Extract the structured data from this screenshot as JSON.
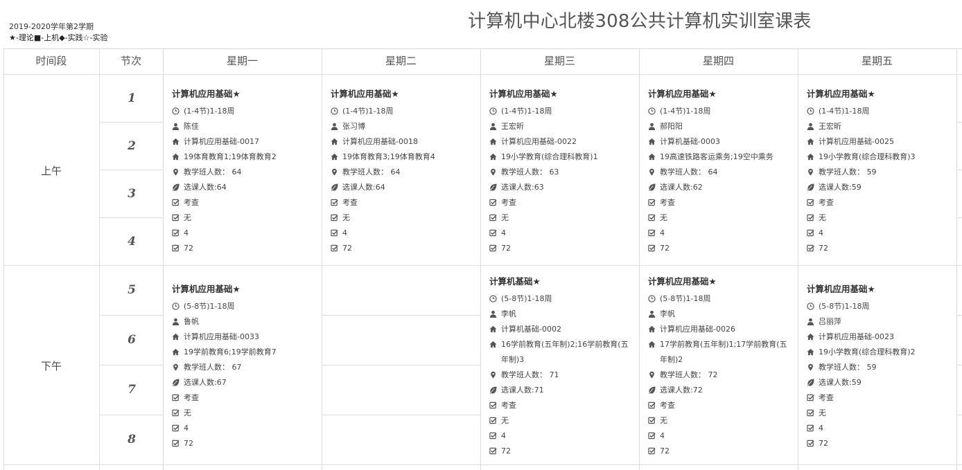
{
  "header": {
    "term": "2019-2020学年第2学期",
    "legend": "★-理论■-上机◆-实践☆-实验",
    "title": "计算机中心北楼308公共计算机实训室课表"
  },
  "columns": {
    "period": "时间段",
    "slot": "节次",
    "days": [
      "星期一",
      "星期二",
      "星期三",
      "星期四",
      "星期五"
    ]
  },
  "periods": [
    "上午",
    "下午"
  ],
  "slots": [
    "1",
    "2",
    "3",
    "4",
    "5",
    "6",
    "7",
    "8"
  ],
  "icons": [
    "clock-icon",
    "user-icon",
    "home-icon",
    "home-icon",
    "marker-icon",
    "leaf-icon",
    "check-icon",
    "check-icon",
    "check-icon",
    "check-icon"
  ],
  "morning": [
    {
      "title": "计算机应用基础★",
      "time": "(1-4节)1-18周",
      "teacher": "陈佳",
      "class_code": "计算机应用基础-0017",
      "classes": "19体育教育1;19体育教育2",
      "class_size": "教学班人数： 64",
      "enrolled": "选课人数:64",
      "exam": "考查",
      "note": "无",
      "weekly": "4",
      "total": "72"
    },
    {
      "title": "计算机应用基础★",
      "time": "(1-4节)1-18周",
      "teacher": "张习博",
      "class_code": "计算机应用基础-0018",
      "classes": "19体育教育3;19体育教育4",
      "class_size": "教学班人数： 64",
      "enrolled": "选课人数:64",
      "exam": "考查",
      "note": "无",
      "weekly": "4",
      "total": "72"
    },
    {
      "title": "计算机应用基础★",
      "time": "(1-4节)1-18周",
      "teacher": "王宏昕",
      "class_code": "计算机应用基础-0022",
      "classes": "19小学教育(综合理科教育)1",
      "class_size": "教学班人数： 63",
      "enrolled": "选课人数:63",
      "exam": "考查",
      "note": "无",
      "weekly": "4",
      "total": "72"
    },
    {
      "title": "计算机应用基础★",
      "time": "(1-4节)1-18周",
      "teacher": "郝阳阳",
      "class_code": "计算机基础-0003",
      "classes": "19高速铁路客运乘务;19空中乘务",
      "class_size": "教学班人数： 64",
      "enrolled": "选课人数:62",
      "exam": "考查",
      "note": "无",
      "weekly": "4",
      "total": "72"
    },
    {
      "title": "计算机应用基础★",
      "time": "(1-4节)1-18周",
      "teacher": "王宏昕",
      "class_code": "计算机应用基础-0025",
      "classes": "19小学教育(综合理科教育)3",
      "class_size": "教学班人数： 59",
      "enrolled": "选课人数:59",
      "exam": "考查",
      "note": "无",
      "weekly": "4",
      "total": "72"
    }
  ],
  "afternoon": [
    {
      "title": "计算机应用基础★",
      "time": "(5-8节)1-18周",
      "teacher": "鲁帆",
      "class_code": "计算机应用基础-0033",
      "classes": "19学前教育6;19学前教育7",
      "class_size": "教学班人数： 67",
      "enrolled": "选课人数:67",
      "exam": "考查",
      "note": "无",
      "weekly": "4",
      "total": "72"
    },
    null,
    {
      "title": "计算机基础★",
      "time": "(5-8节)1-18周",
      "teacher": "李帆",
      "class_code": "计算机基础-0002",
      "classes": "16学前教育(五年制)2;16学前教育(五年制)3",
      "class_size": "教学班人数： 71",
      "enrolled": "选课人数:71",
      "exam": "考查",
      "note": "无",
      "weekly": "4",
      "total": "72"
    },
    {
      "title": "计算机应用基础★",
      "time": "(5-8节)1-18周",
      "teacher": "李帆",
      "class_code": "计算机应用基础-0026",
      "classes": "17学前教育(五年制)1;17学前教育(五年制)2",
      "class_size": "教学班人数： 72",
      "enrolled": "选课人数:72",
      "exam": "考查",
      "note": "无",
      "weekly": "4",
      "total": "72"
    },
    {
      "title": "计算机应用基础★",
      "time": "(5-8节)1-18周",
      "teacher": "吕丽萍",
      "class_code": "计算机应用基础-0023",
      "classes": "19小学教育(综合理科教育)2",
      "class_size": "教学班人数： 59",
      "enrolled": "选课人数:59",
      "exam": "考查",
      "note": "无",
      "weekly": "4",
      "total": "72"
    }
  ]
}
